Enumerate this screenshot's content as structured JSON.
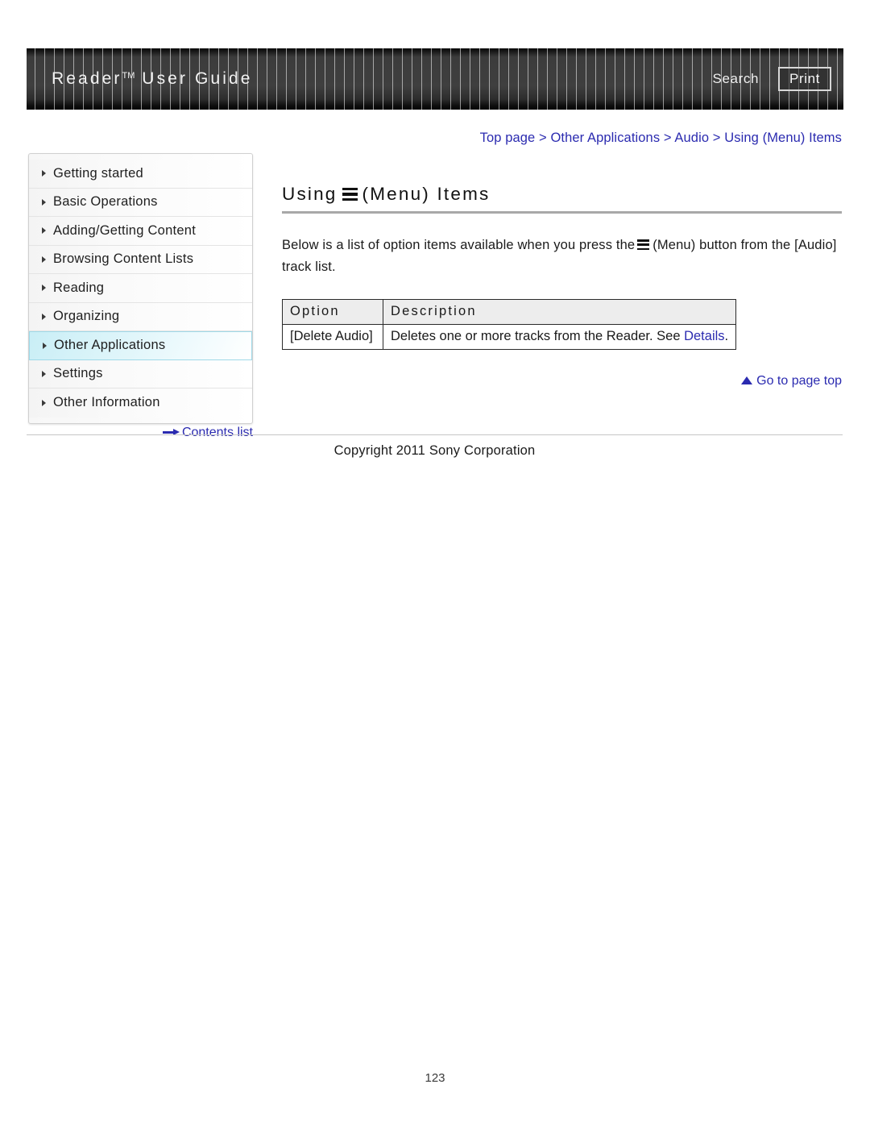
{
  "header": {
    "title": "Reader",
    "title_sup": "TM",
    "title_suffix": " User Guide",
    "search_label": "Search",
    "print_label": "Print"
  },
  "breadcrumb": {
    "full": "Top page > Other Applications > Audio > Using (Menu) Items",
    "items": [
      "Top page",
      "Other Applications",
      "Audio",
      "Using (Menu) Items"
    ],
    "separator": ">",
    "color": "#2b2bb0"
  },
  "sidebar": {
    "items": [
      {
        "label": "Getting started",
        "active": false
      },
      {
        "label": "Basic Operations",
        "active": false
      },
      {
        "label": "Adding/Getting Content",
        "active": false
      },
      {
        "label": "Browsing Content Lists",
        "active": false
      },
      {
        "label": "Reading",
        "active": false
      },
      {
        "label": "Organizing",
        "active": false
      },
      {
        "label": "Other Applications",
        "active": true
      },
      {
        "label": "Settings",
        "active": false
      },
      {
        "label": "Other Information",
        "active": false
      }
    ],
    "contents_list_label": "Contents list",
    "active_highlight_color": "#c9eef6"
  },
  "main": {
    "title_before_icon": "Using",
    "title_icon": "menu-hamburger-icon",
    "title_after_icon": "(Menu) Items",
    "body_before_icon": "Below is a list of option items available when you press the",
    "body_icon": "menu-hamburger-icon",
    "body_after_icon": "(Menu) button from the [Audio] track list.",
    "table": {
      "headers": [
        "Option",
        "Description"
      ],
      "rows": [
        {
          "option": "[Delete Audio]",
          "description_before_link": "Deletes one or more tracks from the Reader. See ",
          "description_link": "Details",
          "description_after_link": "."
        }
      ]
    },
    "go_to_top_label": "Go to page top"
  },
  "footer": {
    "copyright": "Copyright 2011 Sony Corporation",
    "page_number": "123"
  }
}
